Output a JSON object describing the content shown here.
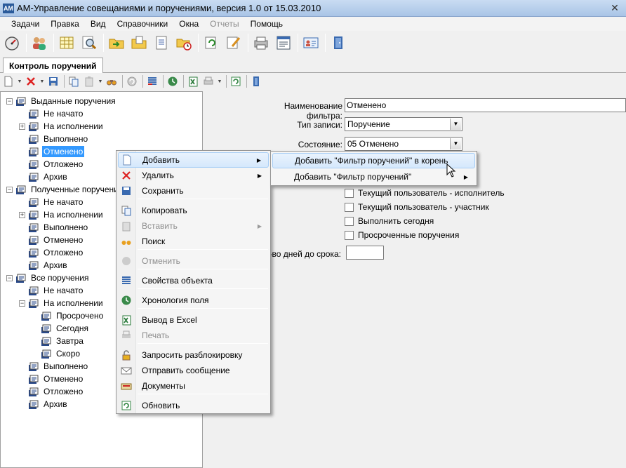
{
  "window": {
    "title": "АМ-Управление совещаниями и поручениями, версия 1.0 от 15.03.2010",
    "app_icon_text": "AM",
    "close_glyph": "✕"
  },
  "menubar": [
    {
      "label": "Задачи",
      "disabled": false
    },
    {
      "label": "Правка",
      "disabled": false
    },
    {
      "label": "Вид",
      "disabled": false
    },
    {
      "label": "Справочники",
      "disabled": false
    },
    {
      "label": "Окна",
      "disabled": false
    },
    {
      "label": "Отчеты",
      "disabled": true
    },
    {
      "label": "Помощь",
      "disabled": false
    }
  ],
  "main_toolbar_icons": [
    "gauge-icon",
    "users-icon",
    "table-icon",
    "magnify-icon",
    "folder-in-icon",
    "folder-out-icon",
    "document-icon",
    "folder-clock-icon",
    "refresh-docs-icon",
    "edit-icon",
    "printer-icon",
    "report-icon",
    "contact-card-icon",
    "exit-door-icon"
  ],
  "tab": {
    "label": "Контроль поручений"
  },
  "tree": {
    "groups": [
      {
        "label": "Выданные поручения",
        "children": [
          {
            "label": "Не начато"
          },
          {
            "label": "На исполнении",
            "expander": "+"
          },
          {
            "label": "Выполнено"
          },
          {
            "label": "Отменено",
            "selected": true
          },
          {
            "label": "Отложено"
          },
          {
            "label": "Архив"
          }
        ]
      },
      {
        "label": "Полученные поручения",
        "children": [
          {
            "label": "Не начато"
          },
          {
            "label": "На исполнении",
            "expander": "+"
          },
          {
            "label": "Выполнено"
          },
          {
            "label": "Отменено"
          },
          {
            "label": "Отложено"
          },
          {
            "label": "Архив"
          }
        ]
      },
      {
        "label": "Все поручения",
        "children": [
          {
            "label": "Не начато"
          },
          {
            "label": "На исполнении",
            "expander": "−",
            "children": [
              {
                "label": "Просрочено"
              },
              {
                "label": "Сегодня"
              },
              {
                "label": "Завтра"
              },
              {
                "label": "Скоро"
              }
            ]
          },
          {
            "label": "Выполнено"
          },
          {
            "label": "Отменено"
          },
          {
            "label": "Отложено"
          },
          {
            "label": "Архив"
          }
        ]
      }
    ]
  },
  "form": {
    "filter_name_label": "Наименование фильтра:",
    "filter_name_value": "Отменено",
    "record_type_label": "Тип записи:",
    "record_type_value": "Поручение",
    "state_label": "Состояние:",
    "state_value": "05 Отменено",
    "checkboxes": [
      {
        "label": "Текущий пользователь - исполнитель",
        "checked": false
      },
      {
        "label": "Текущий пользователь - участник",
        "checked": false
      },
      {
        "label": "Выполнить сегодня",
        "checked": false
      },
      {
        "label": "Просроченные поручения",
        "checked": false
      }
    ],
    "days_label": "Кол-во дней до срока:",
    "days_value": ""
  },
  "context_menu": {
    "items": [
      {
        "label": "Добавить",
        "icon": "new-document-icon",
        "submenu": true,
        "hover": true,
        "disabled": false
      },
      {
        "label": "Удалить",
        "icon": "delete-x-icon",
        "submenu": true,
        "disabled": false
      },
      {
        "label": "Сохранить",
        "icon": "save-icon",
        "disabled": false
      },
      {
        "label": "Копировать",
        "icon": "copy-icon",
        "disabled": false
      },
      {
        "label": "Вставить",
        "icon": "paste-icon",
        "submenu": true,
        "disabled": true
      },
      {
        "label": "Поиск",
        "icon": "binoculars-icon",
        "disabled": false
      },
      {
        "label": "Отменить",
        "icon": "undo-icon",
        "disabled": true
      },
      {
        "label": "Свойства объекта",
        "icon": "properties-icon",
        "disabled": false
      },
      {
        "label": "Хронология поля",
        "icon": "history-icon",
        "disabled": false
      },
      {
        "label": "Вывод в Excel",
        "icon": "excel-icon",
        "disabled": false
      },
      {
        "label": "Печать",
        "icon": "print-icon",
        "disabled": true
      },
      {
        "label": "Запросить разблокировку",
        "icon": "unlock-icon",
        "disabled": false
      },
      {
        "label": "Отправить сообщение",
        "icon": "envelope-icon",
        "disabled": false
      },
      {
        "label": "Документы",
        "icon": "documents-icon",
        "disabled": false
      },
      {
        "label": "Обновить",
        "icon": "refresh-icon",
        "disabled": false
      }
    ]
  },
  "submenu": {
    "items": [
      {
        "label": "Добавить \"Фильтр поручений\" в корень",
        "hover": true
      },
      {
        "label": "Добавить \"Фильтр поручений\"",
        "submenu": true
      }
    ]
  },
  "colors": {
    "selection": "#3399ff",
    "menu_hover": "#d5e8fc",
    "titlebar": "#a9c4e6"
  }
}
